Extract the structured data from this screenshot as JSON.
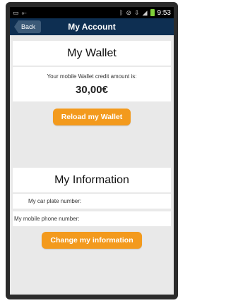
{
  "status_bar": {
    "time": "9:53",
    "icons": [
      "image-icon",
      "usb-icon",
      "bluetooth-icon",
      "mute-icon",
      "download-icon",
      "signal-icon",
      "battery-icon"
    ]
  },
  "header": {
    "back_label": "Back",
    "title": "My Account"
  },
  "wallet": {
    "title": "My Wallet",
    "credit_label": "Your mobile Wallet credit amount is:",
    "credit_amount": "30,00€",
    "reload_button": "Reload my Wallet"
  },
  "information": {
    "title": "My Information",
    "car_plate_label": "My car plate number:",
    "phone_label": "My mobile phone number:",
    "change_button": "Change my information"
  },
  "colors": {
    "header_bg": "#0e2f52",
    "button_bg": "#f39a1d",
    "page_bg": "#e9e9e9"
  }
}
